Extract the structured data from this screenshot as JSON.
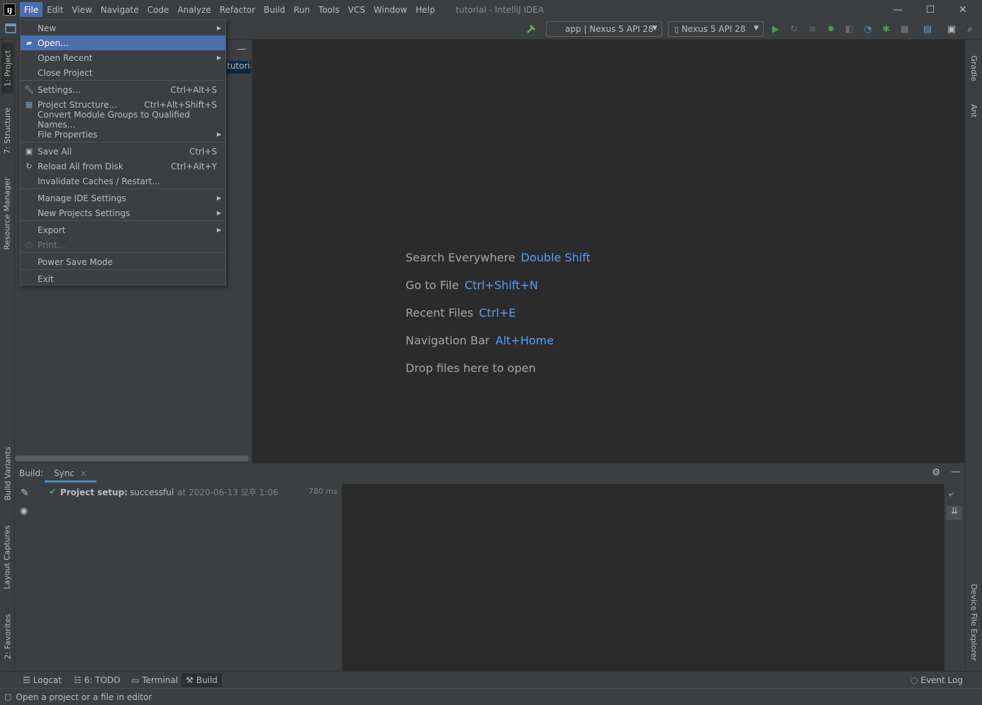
{
  "window": {
    "app_icon": "IJ",
    "title": "tutorial - IntelliJ IDEA",
    "minimize": "—",
    "maximize": "☐",
    "close": "✕"
  },
  "menubar": [
    "File",
    "Edit",
    "View",
    "Navigate",
    "Code",
    "Analyze",
    "Refactor",
    "Build",
    "Run",
    "Tools",
    "VCS",
    "Window",
    "Help"
  ],
  "toolbar": {
    "run_config": "app | Nexus 5 API 28",
    "device": "Nexus 5 API 28"
  },
  "file_menu": {
    "items": [
      {
        "label": "New",
        "shortcut": "",
        "submenu": true,
        "icon": ""
      },
      {
        "label": "Open...",
        "shortcut": "",
        "submenu": false,
        "icon": "folder-icon"
      },
      {
        "label": "Open Recent",
        "shortcut": "",
        "submenu": true,
        "icon": ""
      },
      {
        "label": "Close Project",
        "shortcut": "",
        "submenu": false,
        "icon": ""
      },
      {
        "label": "Settings...",
        "shortcut": "Ctrl+Alt+S",
        "submenu": false,
        "icon": "wrench-icon"
      },
      {
        "label": "Project Structure...",
        "shortcut": "Ctrl+Alt+Shift+S",
        "submenu": false,
        "icon": "project-structure-icon"
      },
      {
        "label": "Convert Module Groups to Qualified Names...",
        "shortcut": "",
        "submenu": false,
        "icon": ""
      },
      {
        "label": "File Properties",
        "shortcut": "",
        "submenu": true,
        "icon": ""
      },
      {
        "label": "Save All",
        "shortcut": "Ctrl+S",
        "submenu": false,
        "icon": "save-icon"
      },
      {
        "label": "Reload All from Disk",
        "shortcut": "Ctrl+Alt+Y",
        "submenu": false,
        "icon": "reload-icon"
      },
      {
        "label": "Invalidate Caches / Restart...",
        "shortcut": "",
        "submenu": false,
        "icon": ""
      },
      {
        "label": "Manage IDE Settings",
        "shortcut": "",
        "submenu": true,
        "icon": ""
      },
      {
        "label": "New Projects Settings",
        "shortcut": "",
        "submenu": true,
        "icon": ""
      },
      {
        "label": "Export",
        "shortcut": "",
        "submenu": true,
        "icon": ""
      },
      {
        "label": "Print...",
        "shortcut": "",
        "submenu": false,
        "icon": "print-icon"
      },
      {
        "label": "Power Save Mode",
        "shortcut": "",
        "submenu": false,
        "icon": ""
      },
      {
        "label": "Exit",
        "shortcut": "",
        "submenu": false,
        "icon": ""
      }
    ]
  },
  "left_tabs": [
    "1: Project",
    "7: Structure",
    "Resource Manager",
    "Build Variants",
    "Layout Captures",
    "2: Favorites"
  ],
  "right_tabs": [
    "Gradle",
    "Ant",
    "Device File Explorer"
  ],
  "project_panel": {
    "node": "tutorial"
  },
  "editor_hints": [
    {
      "label": "Search Everywhere",
      "shortcut": "Double Shift"
    },
    {
      "label": "Go to File",
      "shortcut": "Ctrl+Shift+N"
    },
    {
      "label": "Recent Files",
      "shortcut": "Ctrl+E"
    },
    {
      "label": "Navigation Bar",
      "shortcut": "Alt+Home"
    },
    {
      "label": "Drop files here to open",
      "shortcut": ""
    }
  ],
  "build_panel": {
    "label": "Build:",
    "tab": "Sync",
    "tab_close": "×",
    "row_title": "Project setup:",
    "row_status": "successful",
    "row_time": "at 2020-06-13 오후 1:06",
    "row_duration": "780 ms"
  },
  "bottom_tools": [
    {
      "label": "Logcat",
      "icon": "logcat-icon"
    },
    {
      "label": "6: TODO",
      "icon": "todo-icon"
    },
    {
      "label": "Terminal",
      "icon": "terminal-icon"
    },
    {
      "label": "Build",
      "icon": "hammer-icon"
    }
  ],
  "event_log": "Event Log",
  "status": "Open a project or a file in editor",
  "colors": {
    "accent": "#4b6eaf",
    "link": "#589df6",
    "success": "#499c54"
  }
}
